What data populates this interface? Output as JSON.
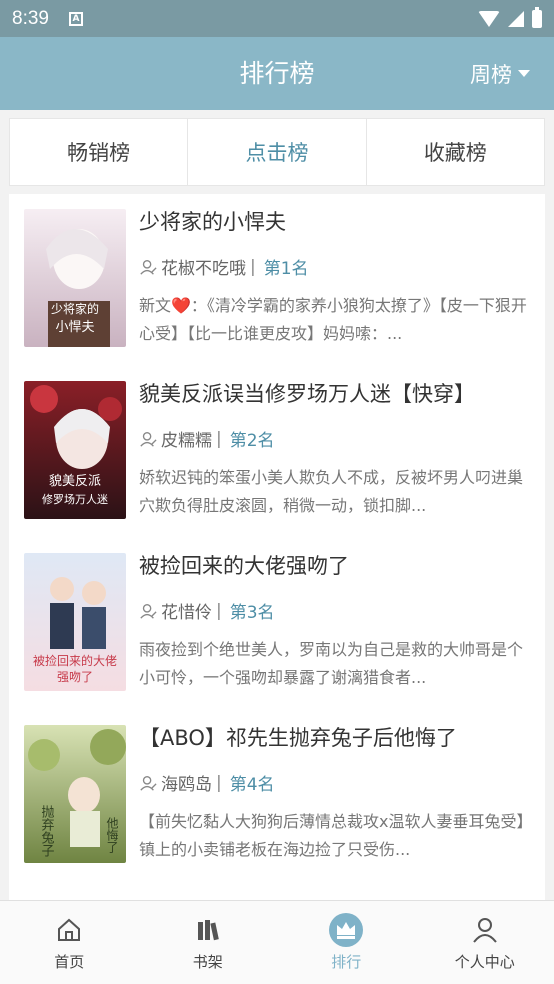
{
  "status": {
    "time": "8:39",
    "notif_icon": "A"
  },
  "header": {
    "title": "排行榜",
    "period": "周榜"
  },
  "tabs": [
    {
      "label": "畅销榜",
      "active": false
    },
    {
      "label": "点击榜",
      "active": true
    },
    {
      "label": "收藏榜",
      "active": false
    }
  ],
  "books": [
    {
      "title": "少将家的小悍夫",
      "author": "花椒不吃哦",
      "rank": "第1名",
      "desc": "新文❤️：《清冷学霸的家养小狼狗太撩了》【皮一下狠开心受】【比一比谁更皮攻】妈妈嗦：...",
      "cover_colors": [
        "#f3e8ee",
        "#d9c2cf",
        "#6b4a3c"
      ],
      "cover_text": "少将家的小悍夫"
    },
    {
      "title": "貌美反派误当修罗场万人迷【快穿】",
      "author": "皮糯糯",
      "rank": "第2名",
      "desc": "娇软迟钝的笨蛋小美人欺负人不成，反被坏男人叼进巢穴欺负得肚皮滚圆，稍微一动，锁扣脚...",
      "cover_colors": [
        "#7a1e24",
        "#c9484c",
        "#2a1418"
      ],
      "cover_text": "貌美反派修罗场万人迷"
    },
    {
      "title": "被捡回来的大佬强吻了",
      "author": "花惜伶",
      "rank": "第3名",
      "desc": "雨夜捡到个绝世美人，罗南以为自己是救的大帅哥是个小可怜，一个强吻却暴露了谢漓猎食者...",
      "cover_colors": [
        "#e8eef8",
        "#f4d7dc",
        "#c73a4a"
      ],
      "cover_text": "被捡回来的大佬强吻了"
    },
    {
      "title": "【ABO】祁先生抛弃兔子后他悔了",
      "author": "海鸥岛",
      "rank": "第4名",
      "desc": "【前失忆黏人大狗狗后薄情总裁攻x温软人妻垂耳兔受】镇上的小卖铺老板在海边捡了只受伤...",
      "cover_colors": [
        "#c9d6a4",
        "#7c8f4a",
        "#f2f0d8"
      ],
      "cover_text": "抛弃兔子后他悔了"
    }
  ],
  "nav": [
    {
      "label": "首页",
      "icon": "home-icon",
      "active": false
    },
    {
      "label": "书架",
      "icon": "bookshelf-icon",
      "active": false
    },
    {
      "label": "排行",
      "icon": "crown-icon",
      "active": true
    },
    {
      "label": "个人中心",
      "icon": "person-icon",
      "active": false
    }
  ]
}
